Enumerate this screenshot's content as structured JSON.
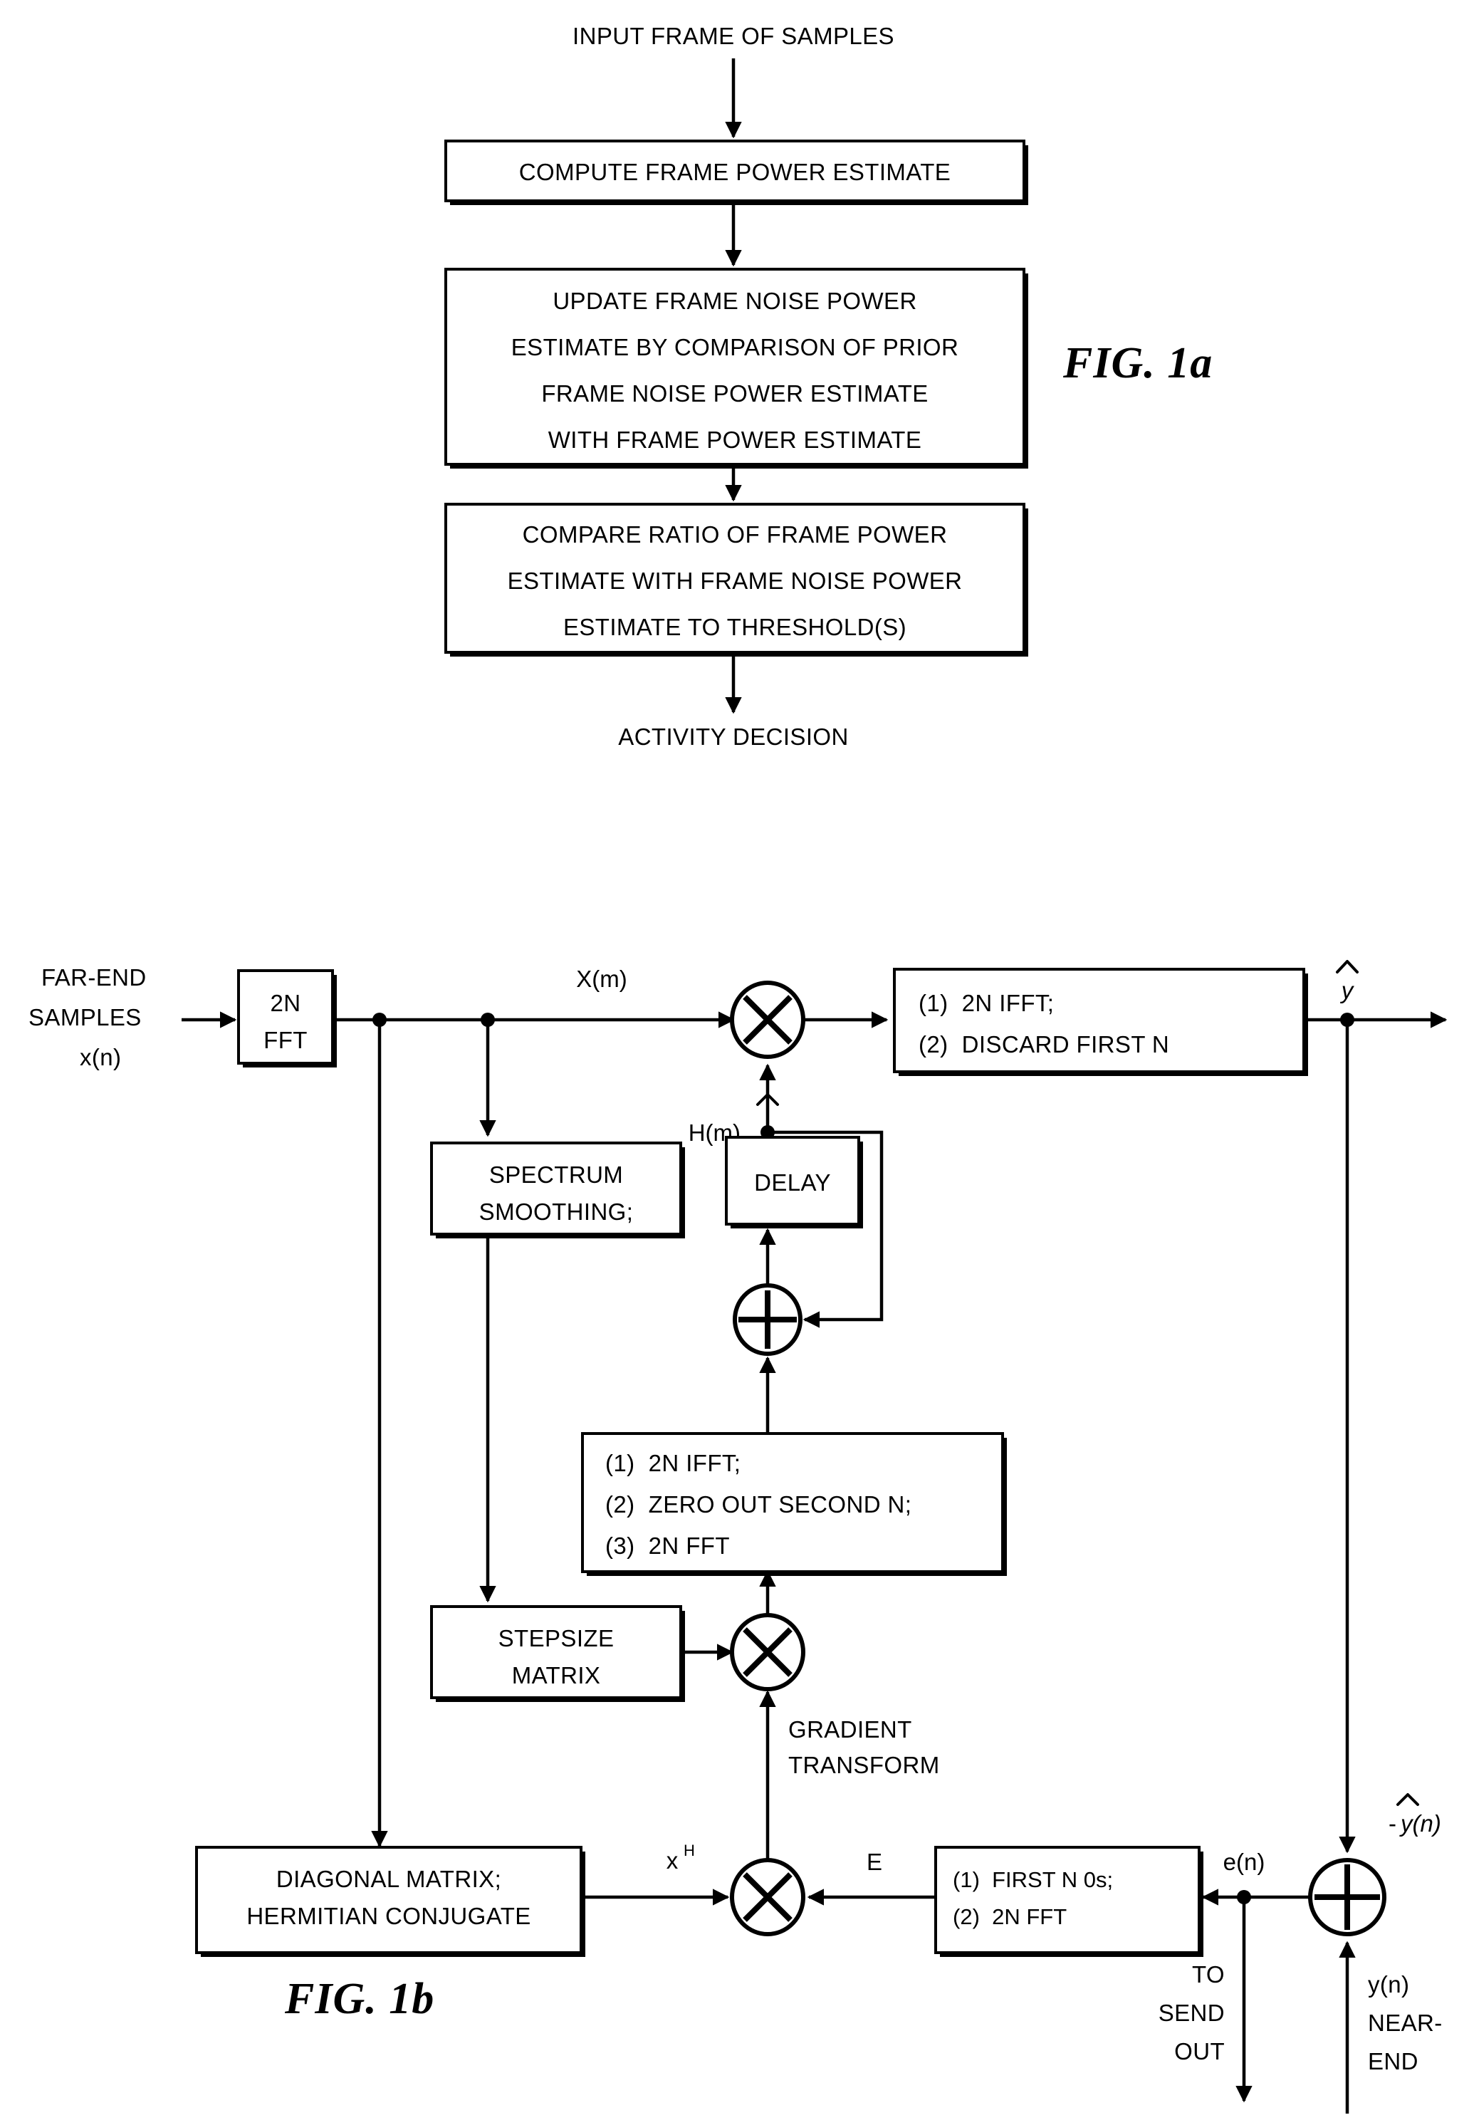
{
  "figure_1a": {
    "label": "FIG. 1a",
    "input_label": "INPUT FRAME OF SAMPLES",
    "output_label": "ACTIVITY DECISION",
    "steps": [
      {
        "id": "compute-frame-power",
        "lines": [
          "COMPUTE FRAME POWER ESTIMATE"
        ]
      },
      {
        "id": "update-noise-power",
        "lines": [
          "UPDATE FRAME NOISE POWER",
          "ESTIMATE BY COMPARISON OF PRIOR",
          "FRAME NOISE POWER ESTIMATE",
          "WITH FRAME POWER ESTIMATE"
        ]
      },
      {
        "id": "compare-ratio",
        "lines": [
          "COMPARE RATIO OF FRAME POWER",
          "ESTIMATE WITH FRAME NOISE POWER",
          "ESTIMATE TO THRESHOLD(S)"
        ]
      }
    ]
  },
  "figure_1b": {
    "label": "FIG. 1b",
    "inputs": {
      "far_end_line1": "FAR-END",
      "far_end_line2": "SAMPLES",
      "far_end_line3": "x(n)",
      "near_end_line1": "y(n)",
      "near_end_line2": "NEAR-",
      "near_end_line3": "END"
    },
    "outputs": {
      "send_out_line1": "TO",
      "send_out_line2": "SEND",
      "send_out_line3": "OUT"
    },
    "blocks": [
      {
        "id": "fft-2n",
        "lines": [
          "2N",
          "FFT"
        ]
      },
      {
        "id": "ifft-discard",
        "lines": [
          "(1)  2N IFFT;",
          "(2)  DISCARD FIRST N"
        ]
      },
      {
        "id": "spectrum-smoothing",
        "lines": [
          "SPECTRUM",
          "SMOOTHING;"
        ]
      },
      {
        "id": "delay",
        "lines": [
          "DELAY"
        ]
      },
      {
        "id": "ifft-zero-fft",
        "lines": [
          "(1)  2N IFFT;",
          "(2)  ZERO OUT SECOND N;",
          "(3)  2N FFT"
        ]
      },
      {
        "id": "stepsize-matrix",
        "lines": [
          "STEPSIZE",
          "MATRIX"
        ]
      },
      {
        "id": "diagonal-matrix",
        "lines": [
          "DIAGONAL MATRIX;",
          "HERMITIAN CONJUGATE"
        ]
      },
      {
        "id": "first-n-zeros-fft",
        "lines": [
          "(1)  FIRST N 0s;",
          "(2)  2N FFT"
        ]
      }
    ],
    "signals": {
      "x_m": "X(m)",
      "h_m_base": "H(m)",
      "y_hat": "y",
      "x_hermitian_base": "x",
      "x_hermitian_sup": "H",
      "error_symbol": "E",
      "e_n": "e(n)",
      "neg_y_hat_n_prefix": "-",
      "neg_y_hat_n_base": "y(n)",
      "gradient_line1": "GRADIENT",
      "gradient_line2": "TRANSFORM"
    },
    "operators": [
      {
        "id": "mult-output",
        "glyph": "multiply"
      },
      {
        "id": "mult-gradient",
        "glyph": "multiply"
      },
      {
        "id": "mult-error",
        "glyph": "multiply"
      },
      {
        "id": "sum-coefficient",
        "glyph": "add"
      },
      {
        "id": "sum-error",
        "glyph": "add"
      }
    ]
  },
  "colors": {
    "ink": "#000000",
    "paper": "#ffffff"
  }
}
